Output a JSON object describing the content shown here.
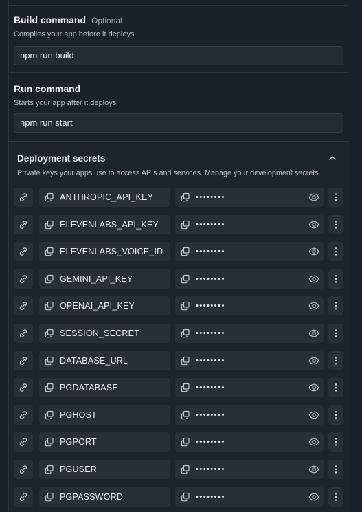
{
  "build": {
    "title": "Build command",
    "optional": "Optional",
    "description": "Compiles your app before it deploys",
    "value": "npm run build"
  },
  "run": {
    "title": "Run command",
    "description": "Starts your app after it deploys",
    "value": "npm run start"
  },
  "secrets": {
    "title": "Deployment secrets",
    "description": "Private keys your apps use to access APIs and services. Manage your development secrets",
    "masked": "••••••••",
    "items": [
      {
        "key": "ANTHROPIC_API_KEY"
      },
      {
        "key": "ELEVENLABS_API_KEY"
      },
      {
        "key": "ELEVENLABS_VOICE_ID"
      },
      {
        "key": "GEMINI_API_KEY"
      },
      {
        "key": "OPENAI_API_KEY"
      },
      {
        "key": "SESSION_SECRET"
      },
      {
        "key": "DATABASE_URL"
      },
      {
        "key": "PGDATABASE"
      },
      {
        "key": "PGHOST"
      },
      {
        "key": "PGPORT"
      },
      {
        "key": "PGUSER"
      },
      {
        "key": "PGPASSWORD"
      }
    ]
  },
  "icons": {
    "link": "link-icon",
    "copy": "copy-icon",
    "eye": "eye-icon",
    "more": "more-vertical-icon",
    "collapse": "chevron-up-icon"
  },
  "colors": {
    "background": "#1c2028",
    "field": "#2a2e37",
    "border": "#2e333d",
    "text": "#eef0f3",
    "muted": "#b6bcc6"
  }
}
